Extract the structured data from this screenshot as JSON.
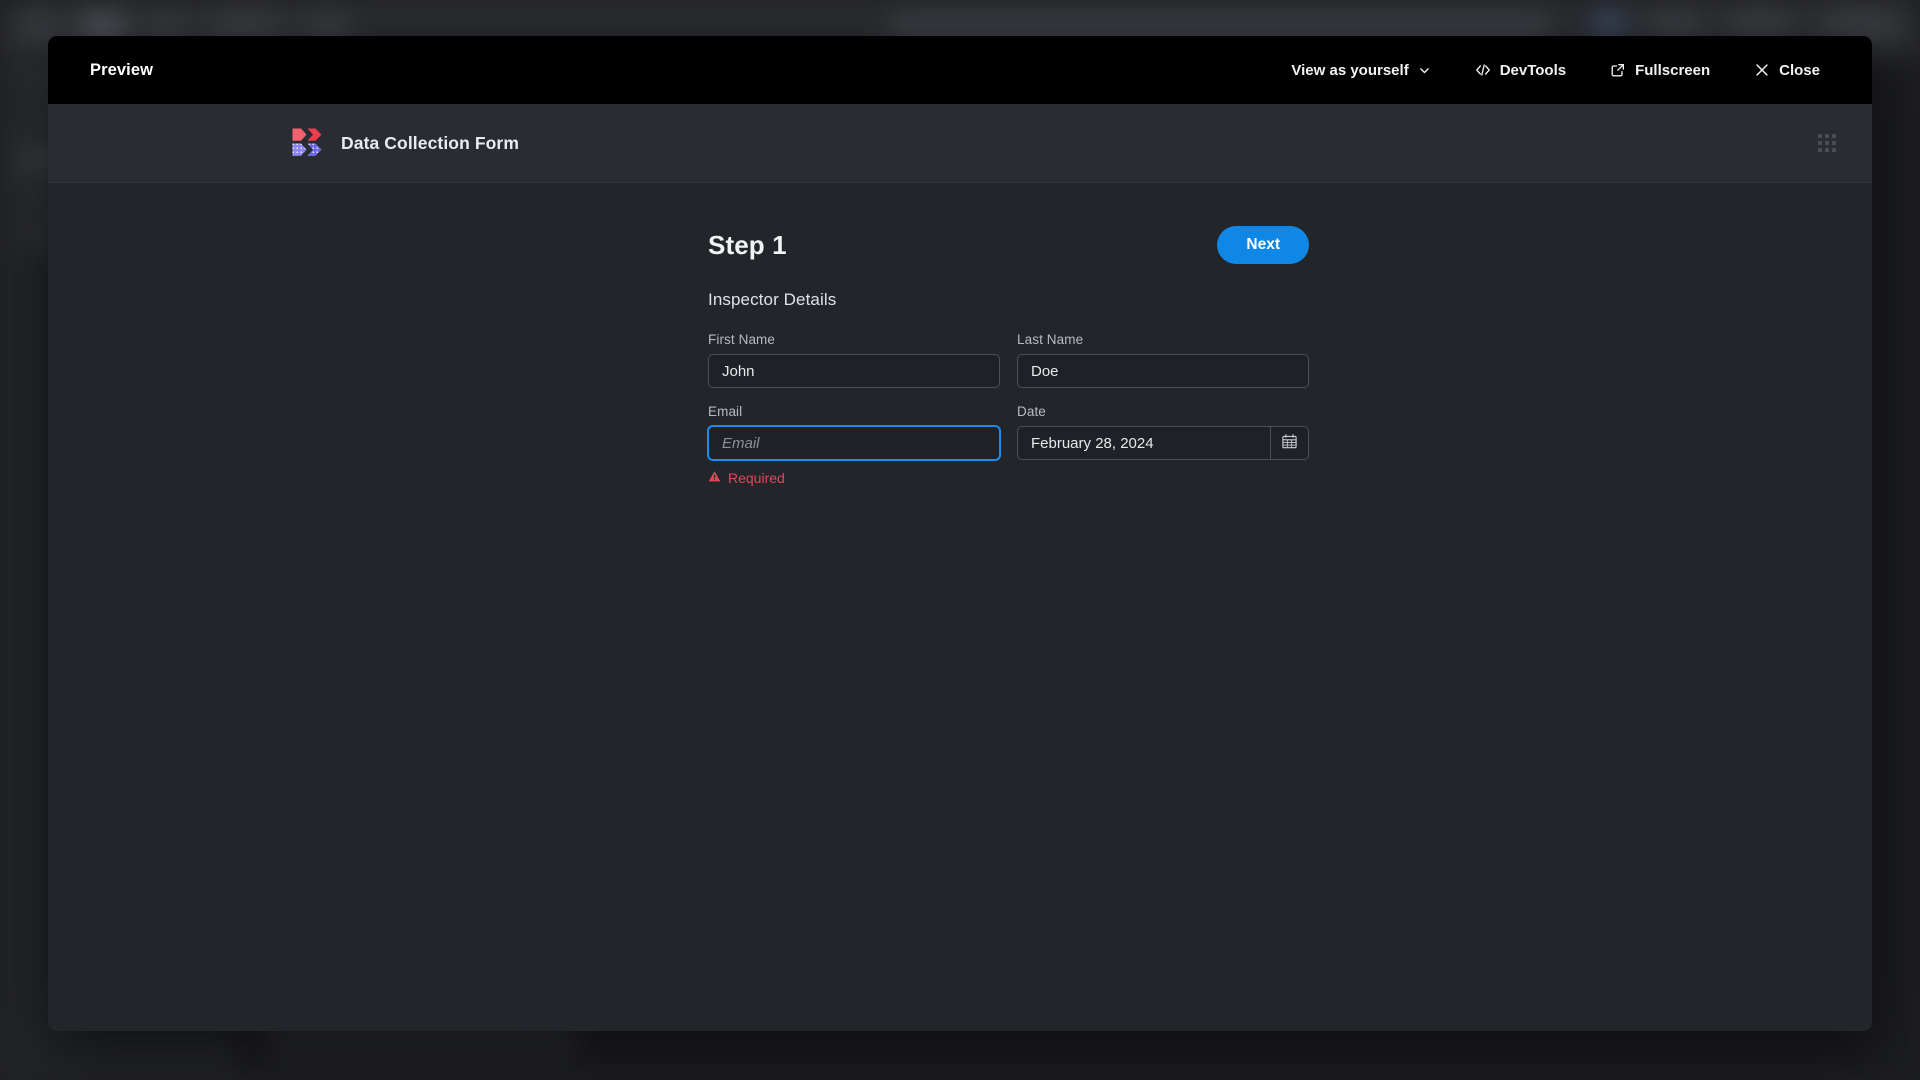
{
  "preview_bar": {
    "title": "Preview",
    "actions": [
      {
        "label": "View as yourself",
        "icon": "chevron-down-icon"
      },
      {
        "label": "DevTools",
        "icon": "code-icon"
      },
      {
        "label": "Fullscreen",
        "icon": "external-link-icon"
      },
      {
        "label": "Close",
        "icon": "close-icon"
      }
    ]
  },
  "form_header": {
    "title": "Data Collection Form",
    "logo_icon": "retool-logo-icon",
    "grip_icon": "grid-dots-icon"
  },
  "form": {
    "step_title": "Step 1",
    "next_label": "Next",
    "section_title": "Inspector Details",
    "fields": [
      {
        "label": "First Name",
        "value": "John",
        "placeholder": "",
        "name": "first-name-input",
        "focused": false,
        "type": "text"
      },
      {
        "label": "Last Name",
        "value": "Doe",
        "placeholder": "",
        "name": "last-name-input",
        "focused": false,
        "type": "text"
      },
      {
        "label": "Email",
        "value": "",
        "placeholder": "Email",
        "name": "email-input",
        "focused": true,
        "type": "text",
        "error": "Required"
      },
      {
        "label": "Date",
        "value": "February 28, 2024",
        "placeholder": "",
        "name": "date-input",
        "focused": false,
        "type": "date"
      }
    ]
  },
  "colors": {
    "accent_blue": "#0f87e7",
    "focus_blue": "#1a8cf0",
    "error_red": "#e64559",
    "modal_body": "#22262b",
    "form_header": "#292d33",
    "preview_bar": "#000000",
    "input_bg": "#1e2227",
    "logo_red_light": "#f4616e",
    "logo_red_dark": "#ee3b4d",
    "logo_purple_light": "#8e86f5",
    "logo_purple_dark": "#6e6af0"
  }
}
